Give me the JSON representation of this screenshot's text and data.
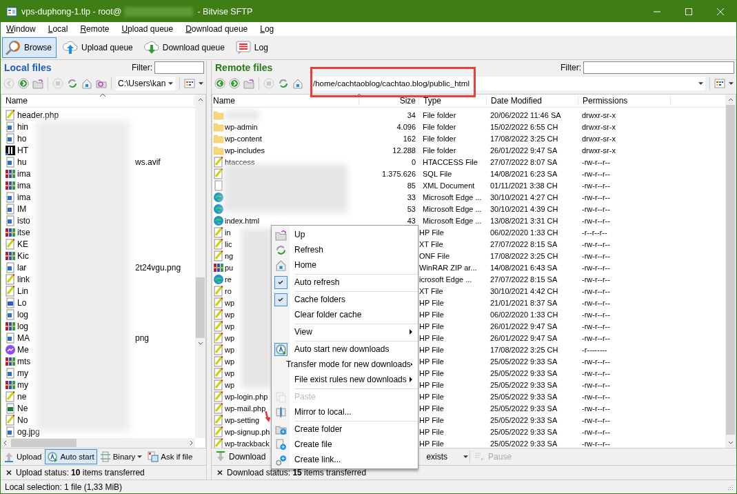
{
  "window": {
    "title_start": "vps-duphong-1.tlp - root@",
    "title_end": "- Bitvise SFTP"
  },
  "menu": [
    "Window",
    "Local",
    "Remote",
    "Upload queue",
    "Download queue",
    "Log"
  ],
  "toolbar": [
    {
      "label": "Browse",
      "kind": "browse",
      "selected": true
    },
    {
      "label": "Upload queue",
      "kind": "upload",
      "selected": false
    },
    {
      "label": "Download queue",
      "kind": "download",
      "selected": false
    },
    {
      "label": "Log",
      "kind": "log",
      "selected": false
    }
  ],
  "local": {
    "title": "Local files",
    "filter_label": "Filter:",
    "path": "C:\\Users\\kan",
    "column": "Name",
    "rows": [
      {
        "name": "header.php",
        "kind": "script"
      },
      {
        "name": "hin",
        "kind": "image"
      },
      {
        "name": "ho",
        "kind": "image"
      },
      {
        "name": "HT",
        "kind": "app"
      },
      {
        "name": "hu",
        "tail": "ws.avif",
        "kind": "image"
      },
      {
        "name": "ima",
        "kind": "archive"
      },
      {
        "name": "ima",
        "kind": "archive"
      },
      {
        "name": "ima",
        "kind": "image"
      },
      {
        "name": "IM",
        "kind": "image"
      },
      {
        "name": "isto",
        "kind": "image"
      },
      {
        "name": "itse",
        "kind": "archive"
      },
      {
        "name": "KE",
        "kind": "script"
      },
      {
        "name": "Kic",
        "kind": "archive"
      },
      {
        "name": "lar",
        "tail": "2t24vgu.png",
        "kind": "image"
      },
      {
        "name": "link",
        "kind": "script"
      },
      {
        "name": "Lin",
        "kind": "script"
      },
      {
        "name": "Lo",
        "kind": "word"
      },
      {
        "name": "log",
        "kind": "image"
      },
      {
        "name": "log",
        "kind": "archive"
      },
      {
        "name": "MA",
        "tail": "png",
        "kind": "image"
      },
      {
        "name": "Me",
        "kind": "chat"
      },
      {
        "name": "mts",
        "kind": "archive"
      },
      {
        "name": "my",
        "kind": "image"
      },
      {
        "name": "my",
        "kind": "archive"
      },
      {
        "name": "ne",
        "kind": "script"
      },
      {
        "name": "Ne",
        "kind": "excel"
      },
      {
        "name": "No",
        "kind": "script"
      },
      {
        "name": "og.jpg",
        "kind": "image"
      }
    ],
    "actions": [
      {
        "label": "Upload",
        "kind": "upload",
        "selected": false
      },
      {
        "label": "Auto start",
        "kind": "autostart",
        "selected": true
      },
      {
        "label": "Binary",
        "kind": "binary",
        "selected": false
      },
      {
        "label": "Ask if file",
        "kind": "ask",
        "selected": false
      }
    ],
    "status": "Upload status: **10** items transferred"
  },
  "remote": {
    "title": "Remote files",
    "filter_label": "Filter:",
    "path": "/home/cachtaoblog/cachtao.blog/public_html",
    "columns": [
      "Name",
      "Size",
      "Type",
      "Date Modified",
      "Permissions"
    ],
    "rows": [
      {
        "name": "",
        "kind": "folder",
        "size": "34",
        "type": "File folder",
        "date": "20/06/2022 11:46 SA",
        "perm": "drwxr-sr-x"
      },
      {
        "name": "wp-admin",
        "kind": "folder",
        "size": "4.096",
        "type": "File folder",
        "date": "15/02/2022 6:55 CH",
        "perm": "drwxr-sr-x"
      },
      {
        "name": "wp-content",
        "kind": "folder",
        "size": "162",
        "type": "File folder",
        "date": "17/08/2022 3:25 CH",
        "perm": "drwxr-sr-x"
      },
      {
        "name": "wp-includes",
        "kind": "folder",
        "size": "12.288",
        "type": "File folder",
        "date": "26/01/2022 9:47 SA",
        "perm": "drwxr-sr-x"
      },
      {
        "name": "htaccess",
        "kind": "script",
        "size": "0",
        "type": "HTACCESS File",
        "date": "27/07/2022 8:07 SA",
        "perm": "-rw-r--r--"
      },
      {
        "name": "",
        "kind": "script",
        "size": "1.375.626",
        "type": "SQL File",
        "date": "14/08/2021 6:23 SA",
        "perm": "-rw-r--r--"
      },
      {
        "name": "",
        "kind": "blank",
        "size": "85",
        "type": "XML Document",
        "date": "01/11/2021 3:38 CH",
        "perm": "-rw-r--r--"
      },
      {
        "name": "",
        "kind": "edge",
        "size": "33",
        "type": "Microsoft Edge ...",
        "date": "30/10/2021 4:27 CH",
        "perm": "-rw-r--r--"
      },
      {
        "name": "",
        "kind": "edge",
        "size": "53",
        "type": "Microsoft Edge ...",
        "date": "30/10/2021 4:39 CH",
        "perm": "-rw-r--r--"
      },
      {
        "name": "index.html",
        "kind": "edge",
        "size": "43",
        "type": "Microsoft Edge ...",
        "date": "13/08/2021 3:31 CH",
        "perm": "-rw-r--r--"
      },
      {
        "name": "in",
        "kind": "script",
        "type": "HP File",
        "date": "06/02/2020 1:33 CH",
        "perm": "-r--r--r--"
      },
      {
        "name": "lic",
        "kind": "script",
        "type": "XT File",
        "date": "27/07/2022 8:15 SA",
        "perm": "-rw-r--r--"
      },
      {
        "name": "ng",
        "kind": "script",
        "type": "ONF File",
        "date": "17/08/2022 3:25 CH",
        "perm": "-rw-r--r--"
      },
      {
        "name": "pu",
        "kind": "archive",
        "type": "WinRAR ZIP ar...",
        "date": "14/08/2021 6:43 SA",
        "perm": "-rw-r--r--"
      },
      {
        "name": "re",
        "kind": "edge",
        "type": "icrosoft Edge ...",
        "date": "27/07/2022 8:15 SA",
        "perm": "-rw-r--r--"
      },
      {
        "name": "ro",
        "kind": "script",
        "type": "XT File",
        "date": "30/10/2021 4:42 CH",
        "perm": "-rw-r--r--"
      },
      {
        "name": "wp",
        "kind": "script",
        "type": "HP File",
        "date": "21/01/2021 8:37 SA",
        "perm": "-rw-r--r--"
      },
      {
        "name": "wp",
        "kind": "script",
        "type": "HP File",
        "date": "06/02/2020 1:33 CH",
        "perm": "-rw-r--r--"
      },
      {
        "name": "wp",
        "kind": "script",
        "type": "HP File",
        "date": "26/01/2022 9:47 SA",
        "perm": "-rw-r--r--"
      },
      {
        "name": "wp",
        "kind": "script",
        "type": "HP File",
        "date": "26/01/2022 9:47 SA",
        "perm": "-rw-r--r--"
      },
      {
        "name": "wp",
        "kind": "script",
        "type": "HP File",
        "date": "17/08/2022 3:25 CH",
        "perm": "-r--------"
      },
      {
        "name": "wp",
        "kind": "script",
        "type": "HP File",
        "date": "25/05/2022 9:33 SA",
        "perm": "-rw-r--r--"
      },
      {
        "name": "wp",
        "kind": "script",
        "type": "HP File",
        "date": "25/05/2022 9:33 SA",
        "perm": "-rw-r--r--"
      },
      {
        "name": "wp",
        "kind": "script",
        "type": "HP File",
        "date": "25/05/2022 9:33 SA",
        "perm": "-rw-r--r--"
      },
      {
        "name": "wp-login.php",
        "kind": "script",
        "type": "HP File",
        "date": "25/05/2022 9:33 SA",
        "perm": "-rw-r--r--"
      },
      {
        "name": "wp-mail.php",
        "kind": "script",
        "type": "HP File",
        "date": "25/05/2022 9:33 SA",
        "perm": "-rw-r--r--"
      },
      {
        "name": "wp-setting",
        "kind": "script",
        "type": "HP File",
        "date": "25/05/2022 9:33 SA",
        "perm": "-rw-r--r--"
      },
      {
        "name": "wp-signup.ph",
        "kind": "script",
        "type": "HP File",
        "date": "25/05/2022 9:33 SA",
        "perm": "-rw-r--r--"
      },
      {
        "name": "wp-trackback",
        "kind": "script",
        "type": "HP File",
        "date": "25/05/2022 9:33 SA",
        "perm": "-rw-r--r--"
      }
    ],
    "actions": [
      {
        "label": "Download",
        "kind": "download",
        "disabled": false
      },
      {
        "label": "exists",
        "kind": "dropdown",
        "disabled": false
      },
      {
        "label": "Pause",
        "kind": "pause",
        "disabled": true
      }
    ],
    "status": "Download status: **15** items transferred"
  },
  "context_menu": {
    "items": [
      {
        "label": "Up",
        "kind": "up",
        "checked": false,
        "disabled": false,
        "submenu": false,
        "separator_after": false
      },
      {
        "label": "Refresh",
        "kind": "refresh",
        "checked": false,
        "disabled": false,
        "submenu": false,
        "separator_after": false
      },
      {
        "label": "Home",
        "kind": "home",
        "checked": false,
        "disabled": false,
        "submenu": false,
        "separator_after": true
      },
      {
        "label": "Auto refresh",
        "kind": "check",
        "checked": true,
        "disabled": false,
        "submenu": false,
        "separator_after": true
      },
      {
        "label": "Cache folders",
        "kind": "check",
        "checked": true,
        "disabled": false,
        "submenu": false,
        "separator_after": false
      },
      {
        "label": "Clear folder cache",
        "kind": "plain",
        "checked": false,
        "disabled": false,
        "submenu": false,
        "separator_after": true
      },
      {
        "label": "View",
        "kind": "plain",
        "checked": false,
        "disabled": false,
        "submenu": true,
        "separator_after": true
      },
      {
        "label": "Auto start new downloads",
        "kind": "autostart",
        "checked": true,
        "disabled": false,
        "submenu": false,
        "separator_after": false
      },
      {
        "label": "Transfer mode for new downloads",
        "kind": "plain",
        "checked": false,
        "disabled": false,
        "submenu": true,
        "separator_after": false
      },
      {
        "label": "File exist rules new downloads",
        "kind": "plain",
        "checked": false,
        "disabled": false,
        "submenu": true,
        "separator_after": true
      },
      {
        "label": "Paste",
        "kind": "paste",
        "checked": false,
        "disabled": true,
        "submenu": false,
        "separator_after": false
      },
      {
        "label": "Mirror to local...",
        "kind": "mirror",
        "checked": false,
        "disabled": false,
        "submenu": false,
        "separator_after": true
      },
      {
        "label": "Create folder",
        "kind": "newfolder",
        "checked": false,
        "disabled": false,
        "submenu": false,
        "separator_after": false
      },
      {
        "label": "Create file",
        "kind": "newfile",
        "checked": false,
        "disabled": false,
        "submenu": false,
        "separator_after": false
      },
      {
        "label": "Create link...",
        "kind": "newlink",
        "checked": false,
        "disabled": false,
        "submenu": false,
        "separator_after": false
      }
    ]
  },
  "status_bar": "Local selection: 1 file (1,33 MiB)"
}
